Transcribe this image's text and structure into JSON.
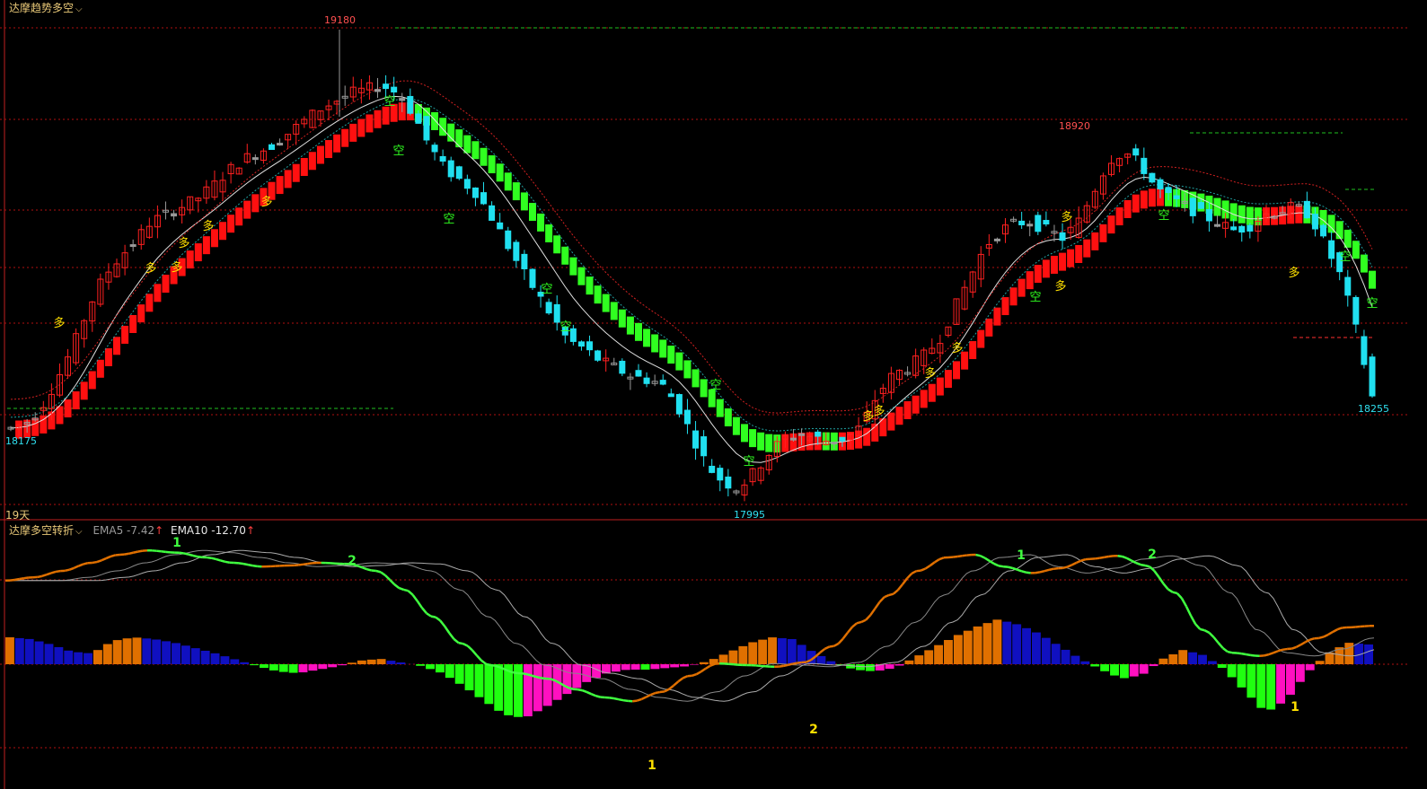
{
  "header": {
    "main_indicator": "达摩趋势多空",
    "sub_indicator": "达摩多空转折",
    "ema5_label": "EMA5",
    "ema5_value": "-7.42",
    "ema10_label": "EMA10",
    "ema10_value": "-12.70",
    "up_arrow": "↑"
  },
  "period_label": "19天",
  "price_labels": {
    "high": "19180",
    "low": "17995",
    "left_low": "18175",
    "right_high": "18920",
    "last": "18255"
  },
  "signal_labels": {
    "bull": "多",
    "bear": "空"
  },
  "wave_labels": {
    "one": "1",
    "two": "2"
  },
  "colors": {
    "up_candle": "#ff2020",
    "down_candle": "#20e0f0",
    "neutral_candle": "#999999",
    "bull_band": "#ff1010",
    "bear_band": "#30ff20",
    "grid": "#b01010",
    "sep": "#c02020",
    "macd_orange": "#e07000",
    "macd_blue": "#1010c0",
    "macd_green": "#20ff10",
    "macd_magenta": "#ff10c0",
    "wave_green": "#40ff40",
    "wave_yellow": "#ffe000"
  },
  "chart_data": [
    {
      "type": "candlestick",
      "title": "达摩趋势多空",
      "ylim": [
        17980,
        19190
      ],
      "extremes": {
        "high": 19180,
        "low": 17995,
        "start_low": 18175,
        "mid_high": 18920,
        "last": 18255
      },
      "close_path": [
        18175,
        18190,
        18230,
        18300,
        18380,
        18480,
        18560,
        18610,
        18650,
        18700,
        18720,
        18740,
        18760,
        18790,
        18830,
        18860,
        18880,
        18900,
        18930,
        18960,
        18990,
        19010,
        19030,
        19040,
        19050,
        19030,
        18980,
        18900,
        18840,
        18810,
        18780,
        18720,
        18650,
        18580,
        18520,
        18460,
        18400,
        18380,
        18350,
        18330,
        18310,
        18300,
        18290,
        18240,
        18160,
        18080,
        18040,
        18020,
        18060,
        18110,
        18150,
        18160,
        18150,
        18140,
        18150,
        18180,
        18260,
        18310,
        18330,
        18360,
        18400,
        18480,
        18560,
        18640,
        18680,
        18700,
        18700,
        18680,
        18660,
        18700,
        18780,
        18860,
        18880,
        18850,
        18790,
        18760,
        18740,
        18720,
        18700,
        18680,
        18690,
        18720,
        18730,
        18740,
        18720,
        18640,
        18560,
        18420,
        18255
      ]
    },
    {
      "type": "line+bar",
      "title": "达摩多空转折",
      "series": [
        {
          "name": "EMA5",
          "last": -7.42
        },
        {
          "name": "EMA10",
          "last": -12.7
        }
      ],
      "ema_wave": [
        0.72,
        0.78,
        0.9,
        1.05,
        1.2,
        1.28,
        1.24,
        1.15,
        1.05,
        0.98,
        1.0,
        1.05,
        1.03,
        0.9,
        0.55,
        0.05,
        -0.45,
        -0.85,
        -1.0,
        -1.1,
        -1.3,
        -1.45,
        -1.52,
        -1.35,
        -1.05,
        -0.82,
        -0.85,
        -0.88,
        -0.8,
        -0.5,
        -0.05,
        0.45,
        0.9,
        1.15,
        1.2,
        0.98,
        0.86,
        0.95,
        1.12,
        1.18,
        1.0,
        0.5,
        -0.2,
        -0.62,
        -0.68,
        -0.55,
        -0.35,
        -0.15,
        -0.12
      ],
      "histogram": [
        0.3,
        0.28,
        0.22,
        0.14,
        0.12,
        0.26,
        0.3,
        0.28,
        0.24,
        0.18,
        0.12,
        0.05,
        -0.02,
        -0.08,
        -0.1,
        -0.06,
        -0.02,
        0.04,
        0.06,
        0.02,
        -0.02,
        -0.1,
        -0.24,
        -0.4,
        -0.56,
        -0.6,
        -0.48,
        -0.34,
        -0.2,
        -0.1,
        -0.06,
        -0.06,
        -0.04,
        -0.02,
        0.04,
        0.14,
        0.24,
        0.3,
        0.28,
        0.14,
        0.02,
        -0.06,
        -0.08,
        -0.04,
        0.08,
        0.2,
        0.32,
        0.42,
        0.5,
        0.44,
        0.34,
        0.2,
        0.06,
        -0.06,
        -0.16,
        -0.12,
        0.06,
        0.16,
        0.1,
        -0.06,
        -0.3,
        -0.54,
        -0.4,
        -0.1,
        0.12,
        0.24,
        0.22
      ],
      "hist_sequence_note_colors": "orange rising positive, blue falling positive, green falling negative, magenta rising negative"
    }
  ]
}
